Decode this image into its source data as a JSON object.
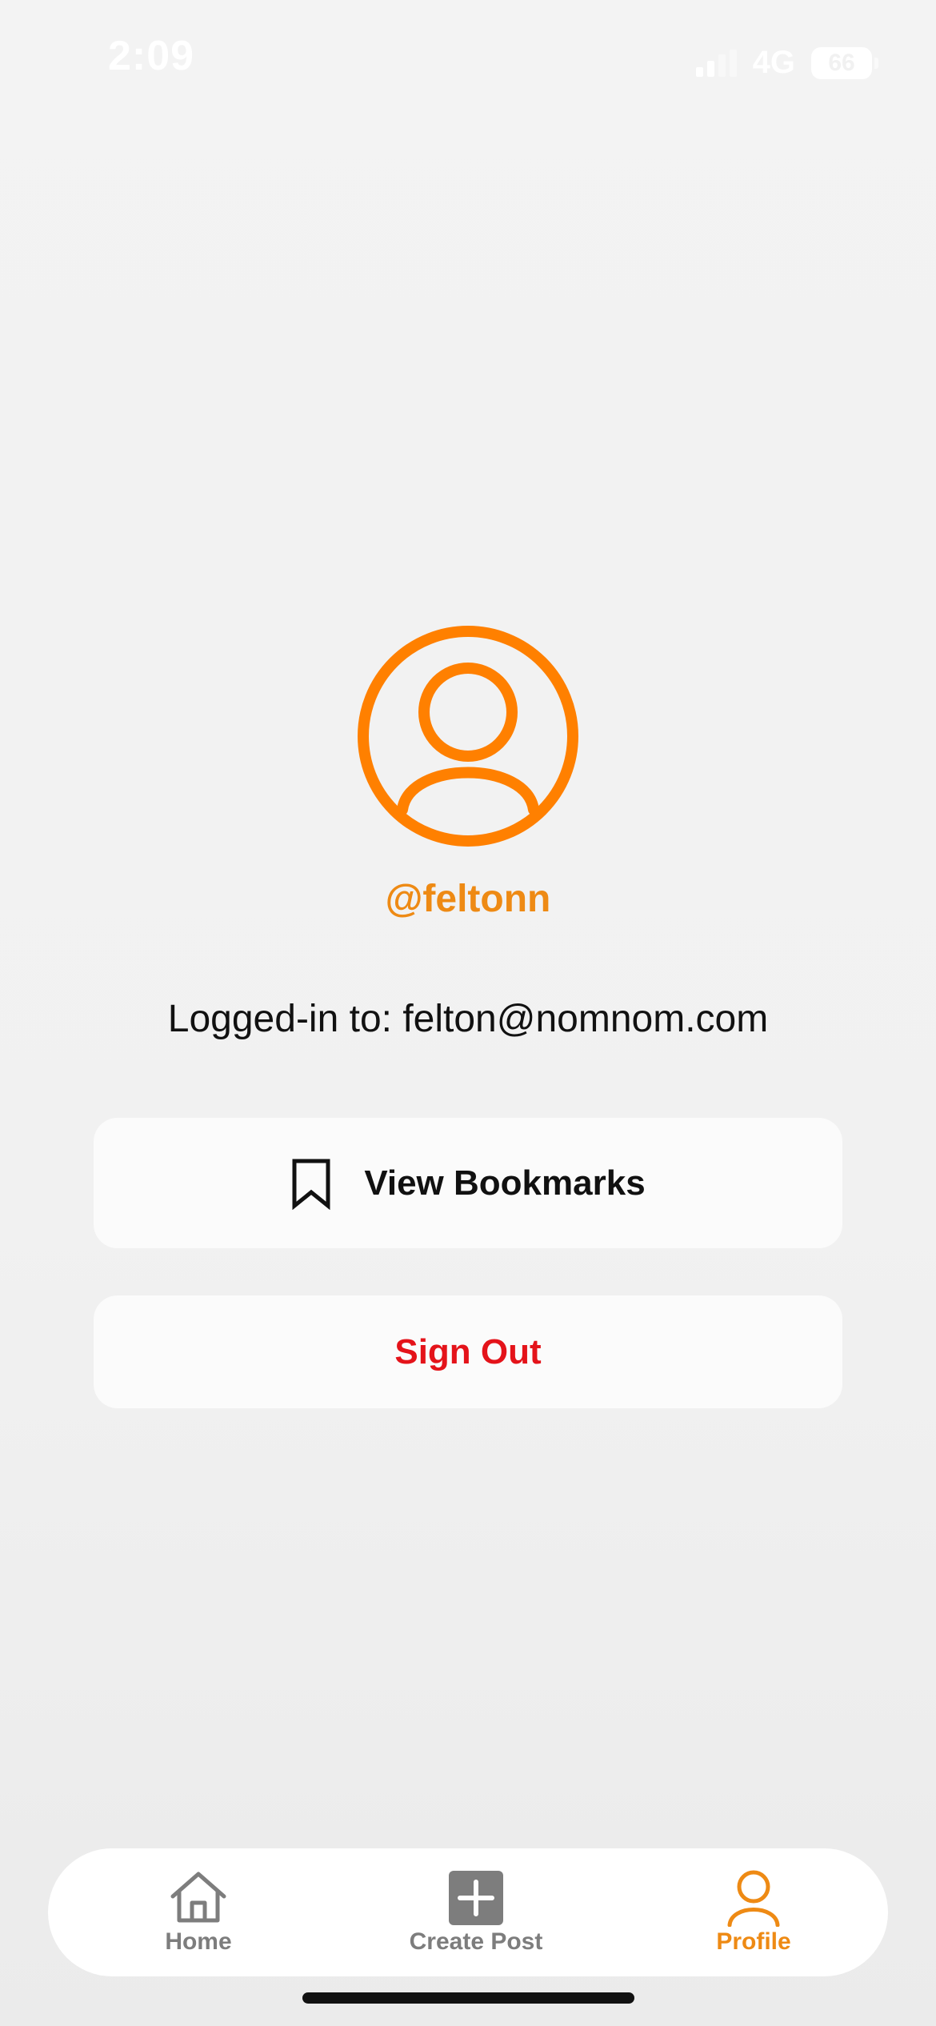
{
  "status_bar": {
    "time": "2:09",
    "network": "4G",
    "battery": "66"
  },
  "profile": {
    "username": "@feltonn",
    "logged_in_text": "Logged-in to: felton@nomnom.com"
  },
  "actions": {
    "view_bookmarks_label": "View Bookmarks",
    "sign_out_label": "Sign Out"
  },
  "tab_bar": {
    "tabs": [
      {
        "label": "Home",
        "icon": "home-icon",
        "active": false
      },
      {
        "label": "Create Post",
        "icon": "plus-square-icon",
        "active": false
      },
      {
        "label": "Profile",
        "icon": "person-icon",
        "active": true
      }
    ]
  },
  "colors": {
    "accent": "#ee8a14",
    "avatar": "#ff8000",
    "destructive": "#e4131a",
    "inactive_tab": "#7d7d7d"
  }
}
